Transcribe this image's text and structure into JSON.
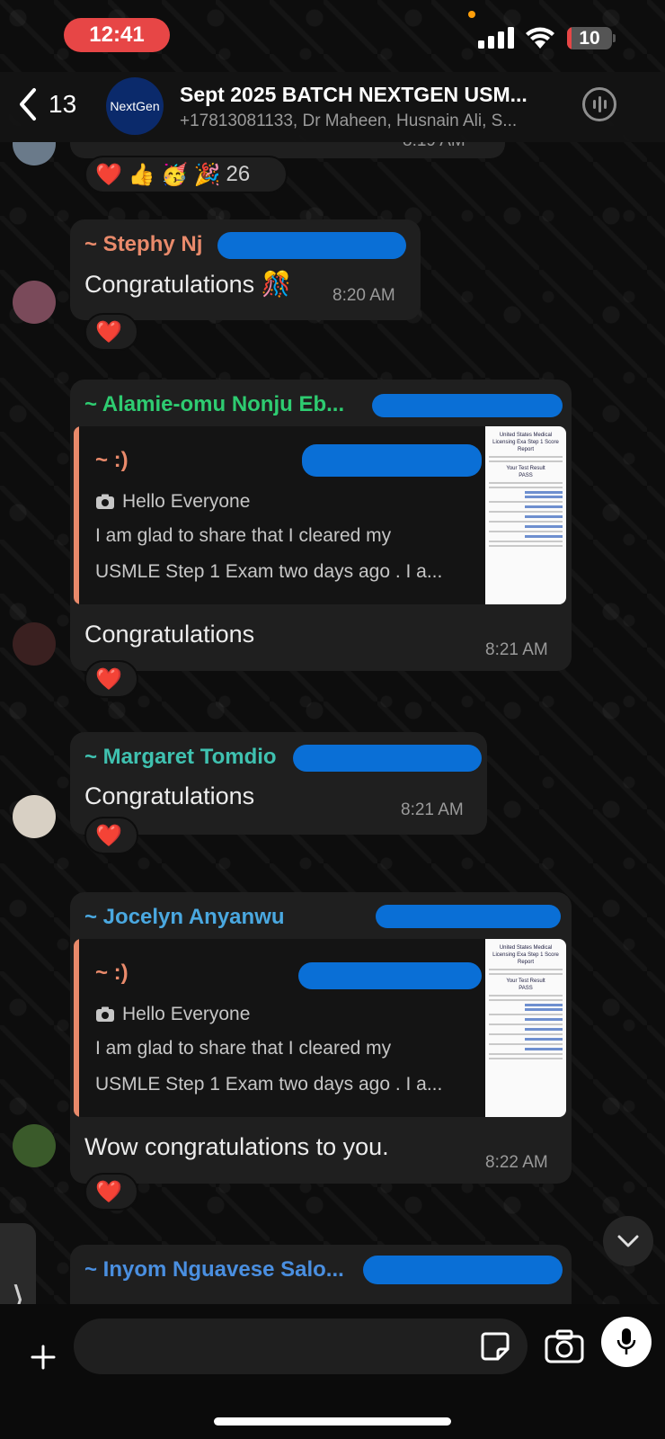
{
  "status_bar": {
    "time": "12:41",
    "battery": "10",
    "battery_level": 0.1
  },
  "header": {
    "back_count": "13",
    "group_avatar_text": "NextGen",
    "title": "Sept  2025 BATCH NEXTGEN USM...",
    "members": "+17813081133, Dr Maheen, Husnain Ali, S..."
  },
  "top_partial": {
    "time": "8:19 AM"
  },
  "top_reaction": {
    "emojis": "❤️ 👍 🥳 🎉",
    "count": "26"
  },
  "messages": [
    {
      "sender": "~ Stephy Nj",
      "sender_color": "#e98a6b",
      "text": "Congratulations 🎊",
      "time": "8:20 AM",
      "reaction": "❤️"
    },
    {
      "sender": "~ Alamie-omu Nonju Eb...",
      "sender_color": "#2ecc71",
      "quote": {
        "author": "~ :)",
        "line1": "Hello Everyone",
        "line2": "I am glad to share that I cleared my",
        "line3": "USMLE Step 1 Exam two days ago  . I a..."
      },
      "text": "Congratulations",
      "time": "8:21 AM",
      "reaction": "❤️"
    },
    {
      "sender": "~ Margaret Tomdio",
      "sender_color": "#3fc1b0",
      "text": "Congratulations",
      "time": "8:21 AM",
      "reaction": "❤️"
    },
    {
      "sender": "~ Jocelyn Anyanwu",
      "sender_color": "#4aa8e0",
      "quote": {
        "author": "~ :)",
        "line1": "Hello Everyone",
        "line2": "I am glad to share that I cleared my",
        "line3": "USMLE Step 1 Exam two days ago  . I a..."
      },
      "text": "Wow congratulations to you.",
      "time": "8:22 AM",
      "reaction": "❤️"
    },
    {
      "sender": "~ Inyom Nguavese Salo...",
      "sender_color": "#4a8fe0"
    }
  ],
  "thumbnail": {
    "heading": "United States Medical Licensing Exa Step 1 Score Report",
    "result_label": "Your Test Result",
    "result": "PASS"
  },
  "colors": {
    "bubble": "#1f1f1f",
    "redaction": "#0a6fd6",
    "time_pill": "#e74646"
  }
}
